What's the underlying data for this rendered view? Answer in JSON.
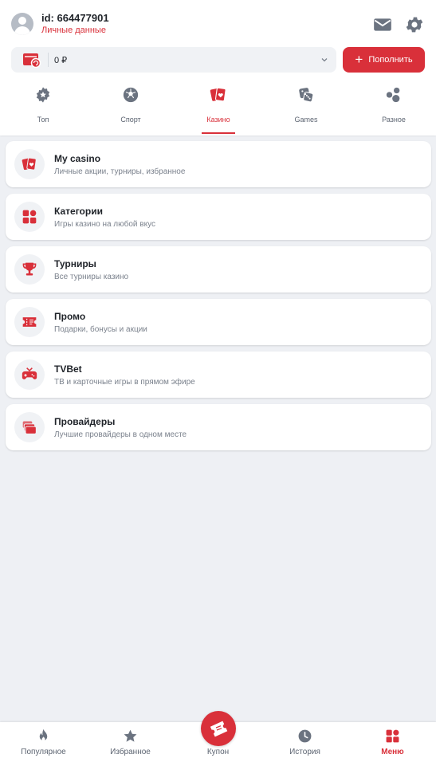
{
  "header": {
    "user_id": "id: 664477901",
    "personal_data_link": "Личные данные",
    "icons": [
      "mail-icon",
      "gear-icon"
    ]
  },
  "balance": {
    "value": "0 ₽",
    "wallet_icon": "wallet-icon",
    "topup_label": "Пополнить"
  },
  "category_tabs": [
    {
      "label": "Топ",
      "icon": "gear-star-icon",
      "active": false
    },
    {
      "label": "Спорт",
      "icon": "soccer-ball-icon",
      "active": false
    },
    {
      "label": "Казино",
      "icon": "playing-cards-icon",
      "active": true
    },
    {
      "label": "Games",
      "icon": "dice-icon",
      "active": false
    },
    {
      "label": "Разное",
      "icon": "bubbles-icon",
      "active": false
    }
  ],
  "menu_items": [
    {
      "title": "My casino",
      "subtitle": "Личные акции, турниры, избранное",
      "icon": "playing-cards-icon"
    },
    {
      "title": "Категории",
      "subtitle": "Игры казино на любой вкус",
      "icon": "grid-icon"
    },
    {
      "title": "Турниры",
      "subtitle": "Все турниры казино",
      "icon": "trophy-icon"
    },
    {
      "title": "Промо",
      "subtitle": "Подарки, бонусы и акции",
      "icon": "ticket-icon"
    },
    {
      "title": "TVBet",
      "subtitle": "ТВ и карточные игры в прямом эфире",
      "icon": "tv-gamepad-icon"
    },
    {
      "title": "Провайдеры",
      "subtitle": "Лучшие провайдеры в одном месте",
      "icon": "stack-icon"
    }
  ],
  "bottom_nav": [
    {
      "label": "Популярное",
      "icon": "flame-icon",
      "active": false
    },
    {
      "label": "Избранное",
      "icon": "star-icon",
      "active": false
    },
    {
      "label": "Купон",
      "icon": "coupon-icon",
      "active": false
    },
    {
      "label": "История",
      "icon": "clock-icon",
      "active": false
    },
    {
      "label": "Меню",
      "icon": "grid-icon",
      "active": true
    }
  ],
  "colors": {
    "accent": "#d9303a",
    "icon_gray": "#6b7380",
    "background": "#eef0f4",
    "card": "#ffffff"
  }
}
